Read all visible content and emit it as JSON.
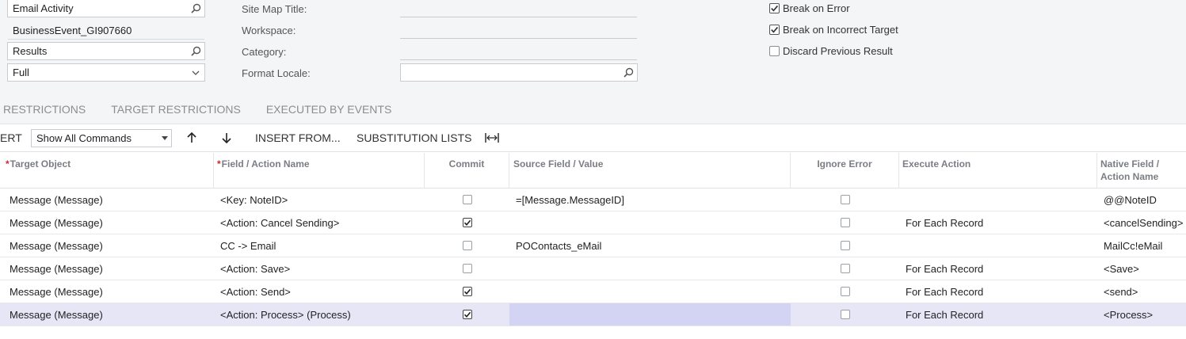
{
  "form": {
    "screen_field": "Email Activity",
    "business_event": "BusinessEvent_GI907660",
    "results_field": "Results",
    "mode_field": "Full",
    "site_map_title_label": "Site Map Title:",
    "workspace_label": "Workspace:",
    "category_label": "Category:",
    "format_locale_label": "Format Locale:",
    "format_locale_value": "",
    "break_on_error": {
      "label": "Break on Error",
      "checked": true
    },
    "break_on_incorrect_target": {
      "label": "Break on Incorrect Target",
      "checked": true
    },
    "discard_previous_result": {
      "label": "Discard Previous Result",
      "checked": false
    }
  },
  "tabs": [
    "RESTRICTIONS",
    "TARGET RESTRICTIONS",
    "EXECUTED BY EVENTS"
  ],
  "toolbar": {
    "insert_label": "ERT",
    "commands_select": "Show All Commands",
    "insert_from_label": "INSERT FROM...",
    "substitution_lists_label": "SUBSTITUTION LISTS"
  },
  "grid": {
    "headers": {
      "target_object": "Target Object",
      "field_action_name": "Field / Action Name",
      "commit": "Commit",
      "source_field_value": "Source Field / Value",
      "ignore_error": "Ignore Error",
      "execute_action": "Execute Action",
      "native_field_line1": "Native Field /",
      "native_field_line2": "Action Name"
    },
    "rows": [
      {
        "target": "Message (Message)",
        "field": "<Key: NoteID>",
        "commit": false,
        "source": "=[Message.MessageID]",
        "ignore": false,
        "execute": "",
        "native": "@@NoteID"
      },
      {
        "target": "Message (Message)",
        "field": "<Action: Cancel Sending>",
        "commit": true,
        "source": "",
        "ignore": false,
        "execute": "For Each Record",
        "native": "<cancelSending>"
      },
      {
        "target": "Message (Message)",
        "field": "CC -> Email",
        "commit": false,
        "source": "POContacts_eMail",
        "ignore": false,
        "execute": "",
        "native": "MailCc!eMail"
      },
      {
        "target": "Message (Message)",
        "field": "<Action: Save>",
        "commit": false,
        "source": "",
        "ignore": false,
        "execute": "For Each Record",
        "native": "<Save>"
      },
      {
        "target": "Message (Message)",
        "field": "<Action: Send>",
        "commit": true,
        "source": "",
        "ignore": false,
        "execute": "For Each Record",
        "native": "<send>"
      },
      {
        "target": "Message (Message)",
        "field": "<Action: Process> (Process)",
        "commit": true,
        "source": "",
        "ignore": false,
        "execute": "For Each Record",
        "native": "<Process>"
      }
    ]
  }
}
